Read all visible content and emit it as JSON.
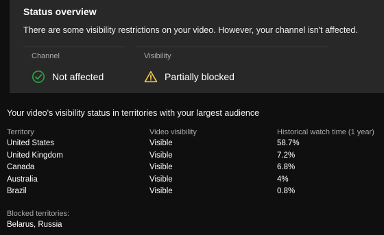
{
  "overview": {
    "title": "Status overview",
    "description": "There are some visibility restrictions on your video. However, your channel isn't affected.",
    "channel": {
      "label": "Channel",
      "value": "Not affected",
      "icon": "check-circle-icon",
      "icon_color": "#2ba640"
    },
    "visibility": {
      "label": "Visibility",
      "value": "Partially blocked",
      "icon": "warning-triangle-icon",
      "icon_color": "#f2c94c"
    }
  },
  "territories": {
    "title": "Your video's visibility status in territories with your largest audience",
    "columns": [
      "Territory",
      "Video visibility",
      "Historical watch time (1 year)"
    ],
    "rows": [
      {
        "territory": "United States",
        "visibility": "Visible",
        "watch_time": "58.7%"
      },
      {
        "territory": "United Kingdom",
        "visibility": "Visible",
        "watch_time": "7.2%"
      },
      {
        "territory": "Canada",
        "visibility": "Visible",
        "watch_time": "6.8%"
      },
      {
        "territory": "Australia",
        "visibility": "Visible",
        "watch_time": "4%"
      },
      {
        "territory": "Brazil",
        "visibility": "Visible",
        "watch_time": "0.8%"
      }
    ],
    "blocked_label": "Blocked territories:",
    "blocked_value": "Belarus, Russia"
  }
}
